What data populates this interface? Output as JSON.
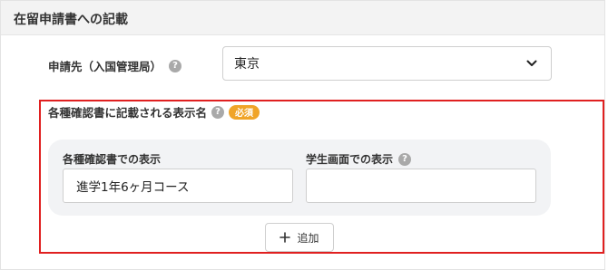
{
  "section": {
    "title": "在留申請書への記載"
  },
  "application_destination": {
    "label": "申請先（入国管理局）",
    "help_icon": "question-circle-icon",
    "selected_value": "東京",
    "chevron_icon": "chevron-down-icon"
  },
  "display_names": {
    "label": "各種確認書に記載される表示名",
    "help_icon": "question-circle-icon",
    "required_badge": "必須",
    "highlight_color": "#e02020",
    "badge_color": "#f0a428",
    "certificate_field": {
      "label": "各種確認書での表示",
      "value": "進学1年6ヶ月コース"
    },
    "student_field": {
      "label": "学生画面での表示",
      "help_icon": "question-circle-icon",
      "value": ""
    },
    "add_button": {
      "icon": "plus-icon",
      "label": "追加"
    }
  }
}
